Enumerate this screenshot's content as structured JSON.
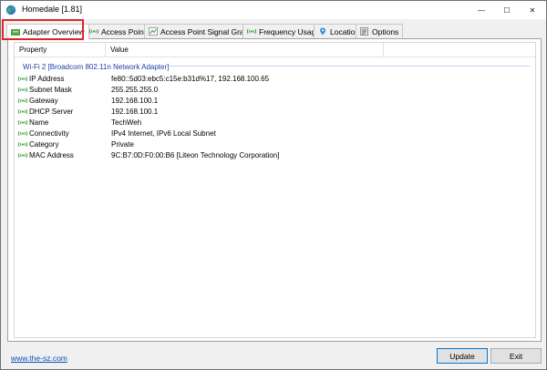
{
  "window": {
    "title": "Homedale [1.81]",
    "minimize_glyph": "—",
    "maximize_glyph": "☐",
    "close_glyph": "✕"
  },
  "tabs": [
    {
      "label": "Adapter Overview",
      "icon": "adapter-icon",
      "active": true
    },
    {
      "label": "Access Points",
      "icon": "signal-icon",
      "active": false
    },
    {
      "label": "Access Point Signal Graph",
      "icon": "graph-icon",
      "active": false
    },
    {
      "label": "Frequency Usage",
      "icon": "signal-icon",
      "active": false
    },
    {
      "label": "Location",
      "icon": "location-pin-icon",
      "active": false
    },
    {
      "label": "Options",
      "icon": "options-icon",
      "active": false
    }
  ],
  "table": {
    "headers": [
      "Property",
      "Value"
    ],
    "group": "Wi-Fi 2 [Broadcom 802.11n Network Adapter]",
    "rows": [
      {
        "property": "IP Address",
        "value": "fe80::5d03:ebc5:c15e:b31d%17, 192.168.100.65"
      },
      {
        "property": "Subnet Mask",
        "value": "255.255.255.0"
      },
      {
        "property": "Gateway",
        "value": "192.168.100.1"
      },
      {
        "property": "DHCP Server",
        "value": "192.168.100.1"
      },
      {
        "property": "Name",
        "value": "TechWeh"
      },
      {
        "property": "Connectivity",
        "value": "IPv4 Internet, IPv6 Local Subnet"
      },
      {
        "property": "Category",
        "value": "Private"
      },
      {
        "property": "MAC Address",
        "value": "9C:B7:0D:F0:00:B6 [Liteon Technology Corporation]"
      }
    ]
  },
  "footer": {
    "link": "www.the-sz.com",
    "update_label": "Update",
    "exit_label": "Exit"
  },
  "colors": {
    "highlight": "#e0242a",
    "group_text": "#1f3fa8",
    "link": "#0b4fb8",
    "signal_green": "#2e9a2e"
  }
}
